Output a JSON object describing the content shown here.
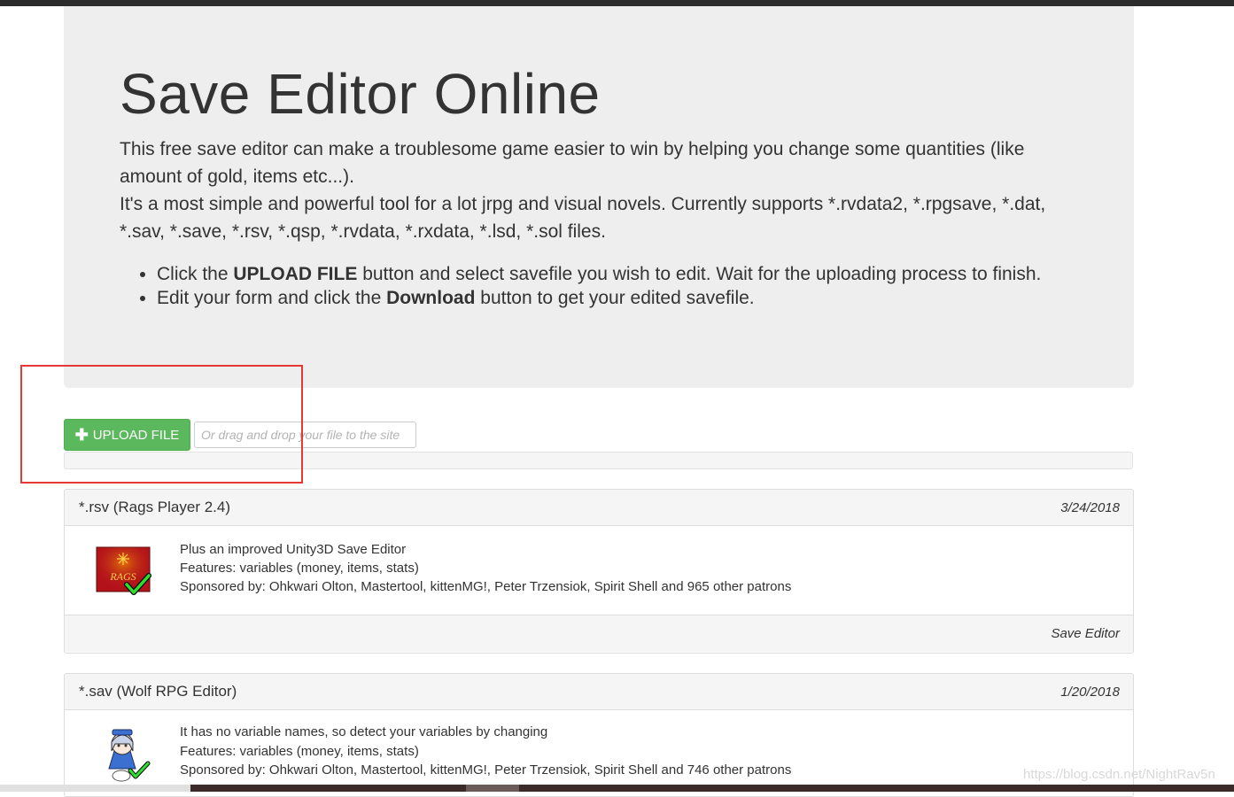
{
  "hero": {
    "title": "Save Editor Online",
    "lead_line1": "This free save editor can make a troublesome game easier to win by helping you change some quantities (like amount of gold, items etc...).",
    "lead_line2": "It's a most simple and powerful tool for a lot jrpg and visual novels. Currently supports *.rvdata2, *.rpgsave, *.dat, *.sav, *.save, *.rsv, *.qsp, *.rvdata, *.rxdata, *.lsd, *.sol files.",
    "steps": [
      {
        "pre": "Click the ",
        "bold": "UPLOAD FILE",
        "post": " button and select savefile you wish to edit. Wait for the uploading process to finish."
      },
      {
        "pre": "Edit your form and click the ",
        "bold": "Download",
        "post": " button to get your edited savefile."
      }
    ]
  },
  "upload": {
    "button_label": "UPLOAD FILE",
    "plus_glyph": "✚",
    "drop_hint": "Or drag and drop your file to the site"
  },
  "cards": [
    {
      "title": "*.rsv (Rags Player 2.4)",
      "date": "3/24/2018",
      "lines": [
        "Plus an improved Unity3D Save Editor",
        "Features: variables (money, items, stats)",
        "Sponsored by: Ohkwari Olton, Mastertool, kittenMG!, Peter Trzensiok, Spirit Shell and 965 other patrons"
      ],
      "thumb_text": "RAGS",
      "footer_link": "Save Editor"
    },
    {
      "title": "*.sav (Wolf RPG Editor)",
      "date": "1/20/2018",
      "lines": [
        "It has no variable names, so detect your variables by changing",
        "Features: variables (money, items, stats)",
        "Sponsored by: Ohkwari Olton, Mastertool, kittenMG!, Peter Trzensiok, Spirit Shell and 746 other patrons"
      ]
    }
  ],
  "watermark": "https://blog.csdn.net/NightRav5n",
  "colors": {
    "upload_green": "#5cb85c",
    "highlight_red": "#e53935",
    "jumbotron_bg": "#eeeeee"
  }
}
